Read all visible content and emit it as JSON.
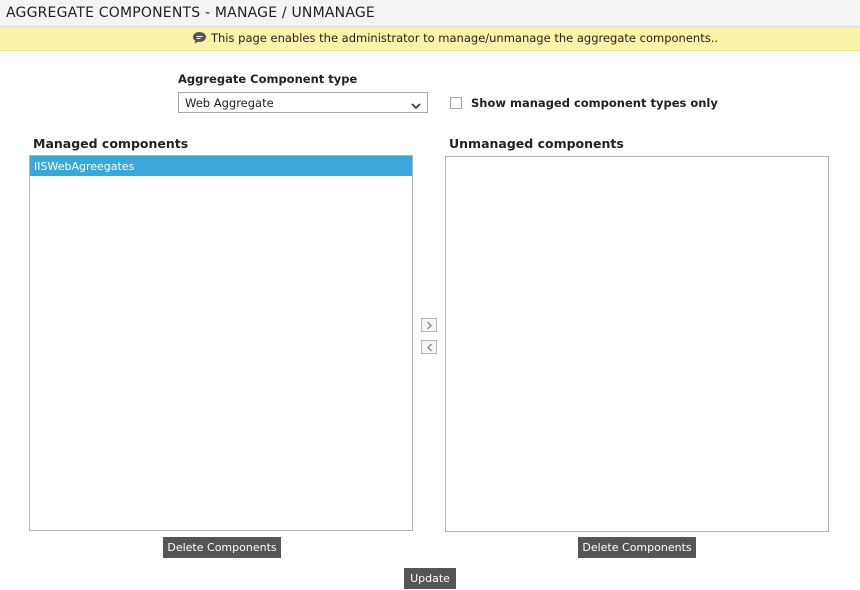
{
  "header": {
    "title": "AGGREGATE COMPONENTS - MANAGE / UNMANAGE"
  },
  "info": {
    "icon": "speech-bubble-icon",
    "text": "This page enables the administrator to manage/unmanage the aggregate components.."
  },
  "filter": {
    "type_label": "Aggregate Component type",
    "type_selected": "Web Aggregate",
    "show_managed_label": "Show managed component types only",
    "show_managed_checked": false
  },
  "managed": {
    "heading": "Managed components",
    "items": [
      "IISWebAgreegates"
    ],
    "delete_label": "Delete Components"
  },
  "unmanaged": {
    "heading": "Unmanaged components",
    "items": [],
    "delete_label": "Delete Components"
  },
  "transfer": {
    "move_right_icon": "chevron-right-icon",
    "move_left_icon": "chevron-left-icon"
  },
  "actions": {
    "update_label": "Update"
  },
  "colors": {
    "selected_item": "#3aa9d9",
    "info_bar": "#fbf3a7",
    "button": "#555555"
  }
}
